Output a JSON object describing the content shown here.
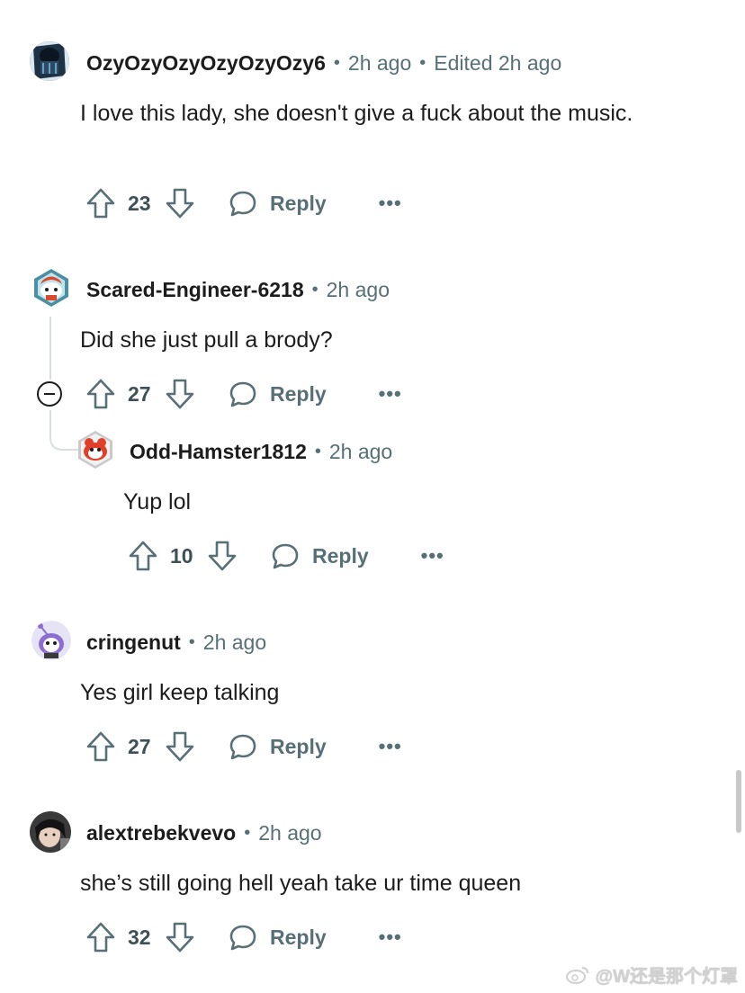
{
  "comments": [
    {
      "username": "OzyOzyOzyOzyOzyOzy6",
      "time": "2h ago",
      "edited": "Edited 2h ago",
      "body": "I love this lady, she doesn't give a fuck about the music.",
      "score": "23",
      "reply_label": "Reply",
      "more_label": "•••",
      "avatar_icon": "alien-avatar-icon"
    },
    {
      "username": "Scared-Engineer-6218",
      "time": "2h ago",
      "body": "Did she just pull a brody?",
      "score": "27",
      "reply_label": "Reply",
      "more_label": "•••",
      "avatar_icon": "snoo-avatar-icon"
    },
    {
      "username": "Odd-Hamster1812",
      "time": "2h ago",
      "body": "Yup lol",
      "score": "10",
      "reply_label": "Reply",
      "more_label": "•••",
      "avatar_icon": "snoo-red-avatar-icon"
    },
    {
      "username": "cringenut",
      "time": "2h ago",
      "body": "Yes girl keep talking",
      "score": "27",
      "reply_label": "Reply",
      "more_label": "•••",
      "avatar_icon": "snoo-purple-avatar-icon"
    },
    {
      "username": "alextrebekvevo",
      "time": "2h ago",
      "body": "she’s still going hell yeah take ur time queen",
      "score": "32",
      "reply_label": "Reply",
      "more_label": "•••",
      "avatar_icon": "photo-avatar-icon"
    }
  ],
  "separator": "•",
  "watermark": "@W还是那个灯罩",
  "colors": {
    "text": "#1c1c1c",
    "muted": "#576f76",
    "thread_line": "#d9dee1"
  }
}
